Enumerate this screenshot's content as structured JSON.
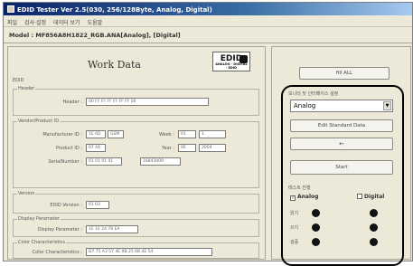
{
  "window": {
    "title": "EDID Tester Ver 2.5(030, 256/128Byte, Analog, Digital)"
  },
  "menu": [
    "파일",
    "검사·설정",
    "데이터 보기",
    "도움말"
  ],
  "model_label": "Model : MF856A8H1822_RGB.ANA[Analog], [Digital]",
  "work": {
    "title": "Work Data",
    "logo_text": "EDID",
    "logo_sub": "ANALOG · DIGITAL · EDID",
    "edid_label": "EDID",
    "header_group": "Header",
    "header_label": "Header :",
    "header_value": "00 FF FF FF FF FF FF 00",
    "vendor_group": "Vendor/Product ID",
    "manufacturer_label": "Manufacturer ID :",
    "manufacturer_value": "1E 6D",
    "manufacturer_code": "GSM",
    "week_label": "Week :",
    "week_value": "01",
    "week_num": "1",
    "product_label": "Product ID :",
    "product_value": "07 4A",
    "year_label": "Year :",
    "year_value": "0E",
    "year_num": "2004",
    "serial_label": "SerialNumber :",
    "serial_value": "01 01 01 01",
    "serial_num": "16843009",
    "version_group": "Version",
    "edid_version_label": "EDID Version :",
    "edid_version_value": "01 03",
    "display_group": "Display Parameter",
    "display_label": "Display Parameter :",
    "display_value": "1E 1E 24 78 EA",
    "color_group": "Color Characteristics",
    "color_label": "Color Characteristics :",
    "color_value": "D7 75 A3 57 4E 9B 25 0B 4E 54"
  },
  "controls": {
    "fill_all_label": "fill ALL",
    "mode_group_label": "모니터 및 인터페이스 설정",
    "mode_selected": "Analog",
    "edit_button_label": "Edit Standard Data",
    "arrow_button_label": "←",
    "start_button_label": "Start",
    "status_group_label": "테스트 진행",
    "analog_checkbox_label": "Analog",
    "analog_checked": "✓",
    "digital_checkbox_label": "Digital",
    "status_rows": [
      "읽기",
      "쓰기",
      "검증"
    ]
  }
}
